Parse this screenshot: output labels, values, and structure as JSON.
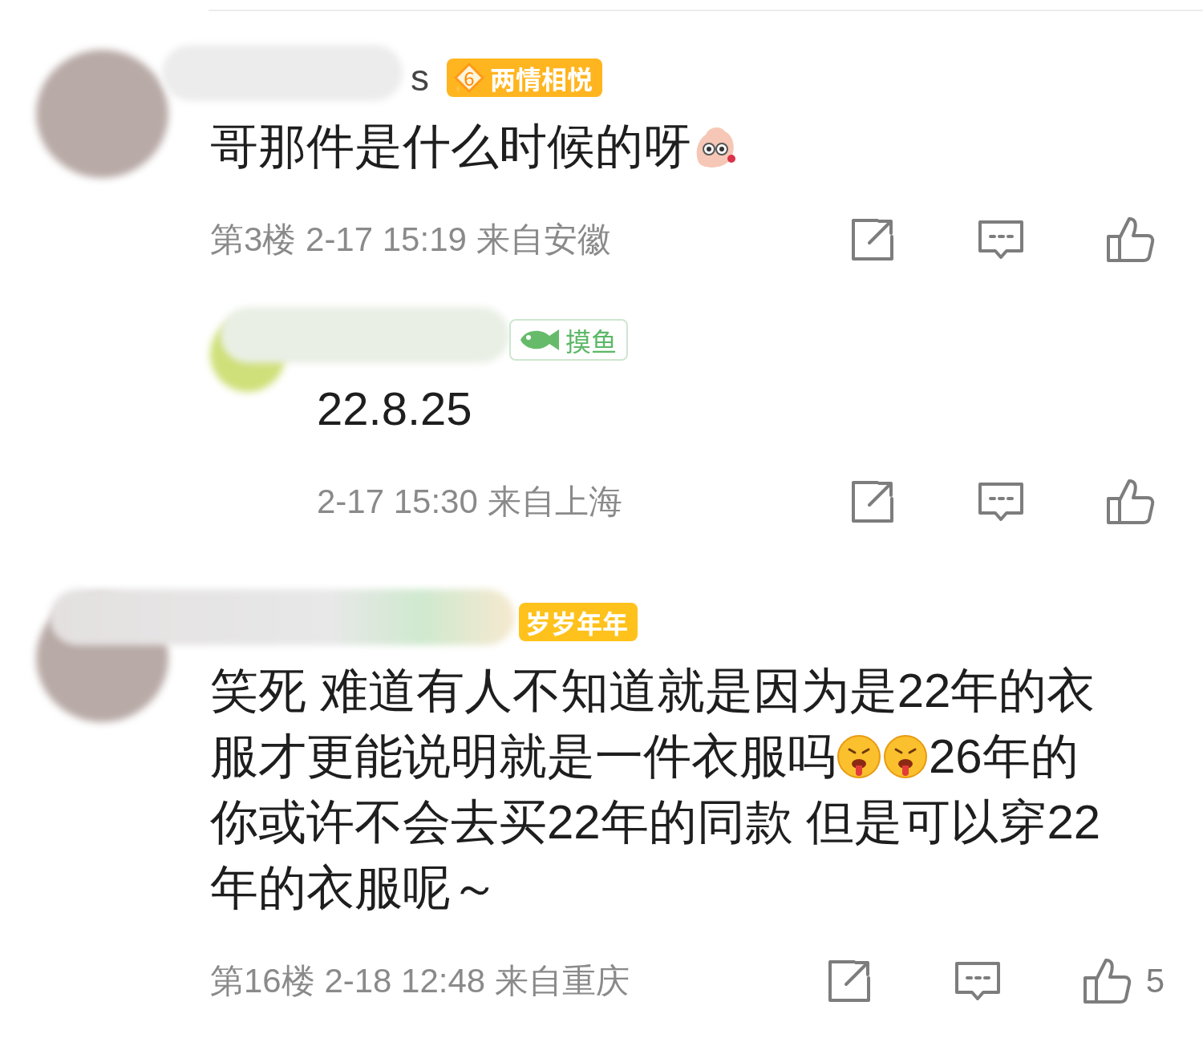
{
  "comments": [
    {
      "kind": "comment",
      "name_fragment": "s",
      "badge": {
        "kind": "level",
        "level_number": "6",
        "label": "两情相悦",
        "color": "#ffb51f"
      },
      "body_lines": [
        [
          {
            "kind": "text",
            "text": "哥那件是什么时候的呀"
          },
          {
            "kind": "sticker"
          }
        ]
      ],
      "meta": "第3楼 2-17 15:19 来自安徽"
    },
    {
      "kind": "reply",
      "badge": {
        "kind": "fish",
        "label": "摸鱼",
        "color": "#5cb867"
      },
      "body_lines": [
        [
          {
            "kind": "text",
            "text": "22.8.25"
          }
        ]
      ],
      "meta": "2-17 15:30 来自上海"
    },
    {
      "kind": "comment",
      "badge": {
        "kind": "plain",
        "label": "岁岁年年",
        "color": "#ffc21c"
      },
      "body_lines": [
        [
          {
            "kind": "text",
            "text": "笑死 难道有人不知道就是因为是22年的衣"
          }
        ],
        [
          {
            "kind": "text",
            "text": "服才更能说明就是一件衣服吗"
          },
          {
            "kind": "face"
          },
          {
            "kind": "face"
          },
          {
            "kind": "text",
            "text": "26年的"
          }
        ],
        [
          {
            "kind": "text",
            "text": "你或许不会去买22年的同款 但是可以穿22"
          }
        ],
        [
          {
            "kind": "text",
            "text": "年的衣服呢～"
          }
        ]
      ],
      "meta": "第16楼 2-18 12:48 来自重庆",
      "likes": "5"
    }
  ]
}
